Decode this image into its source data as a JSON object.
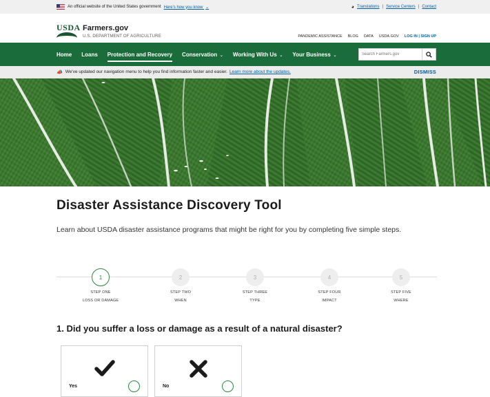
{
  "gov_banner": {
    "official_text": "An official website of the United States government",
    "how_you_know": "Here's how you know",
    "translations": "Translations",
    "service_centers": "Service Centers",
    "contact": "Contact"
  },
  "header": {
    "logo_text": "USDA",
    "site_name": "Farmers.gov",
    "site_subtitle": "U.S. DEPARTMENT OF AGRICULTURE",
    "utility_links": [
      "PANDEMIC ASSISTANCE",
      "BLOG",
      "DATA",
      "USDA.GOV"
    ],
    "login": "LOG IN | SIGN UP"
  },
  "nav": {
    "items": [
      {
        "label": "Home",
        "dropdown": false,
        "active": false
      },
      {
        "label": "Loans",
        "dropdown": false,
        "active": false
      },
      {
        "label": "Protection and Recovery",
        "dropdown": false,
        "active": true
      },
      {
        "label": "Conservation",
        "dropdown": true,
        "active": false
      },
      {
        "label": "Working With Us",
        "dropdown": true,
        "active": false
      },
      {
        "label": "Your Business",
        "dropdown": true,
        "active": false
      }
    ],
    "search_placeholder": "Search Farmers.gov"
  },
  "alert": {
    "text": "We've updated our navigation menu to help you find information faster and easier.",
    "link": "Learn more about the updates.",
    "dismiss": "DISMISS"
  },
  "main": {
    "title": "Disaster Assistance Discovery Tool",
    "intro": "Learn about USDA disaster assistance programs that might be right for you by completing five simple steps.",
    "steps": [
      {
        "number": "1",
        "label": "STEP ONE",
        "sub": "LOSS OR DAMAGE",
        "active": true
      },
      {
        "number": "2",
        "label": "STEP TWO",
        "sub": "WHEN",
        "active": false
      },
      {
        "number": "3",
        "label": "STEP THREE",
        "sub": "TYPE",
        "active": false
      },
      {
        "number": "4",
        "label": "STEP FOUR",
        "sub": "IMPACT",
        "active": false
      },
      {
        "number": "5",
        "label": "STEP FIVE",
        "sub": "WHERE",
        "active": false
      }
    ],
    "question": "1. Did you suffer a loss or damage as a result of a natural disaster?",
    "choices": [
      {
        "label": "Yes",
        "icon": "checkmark-icon"
      },
      {
        "label": "No",
        "icon": "x-icon"
      }
    ]
  },
  "colors": {
    "nav_green": "#1a6d3b",
    "accent_green": "#2e8540",
    "link_blue": "#005ea2"
  }
}
